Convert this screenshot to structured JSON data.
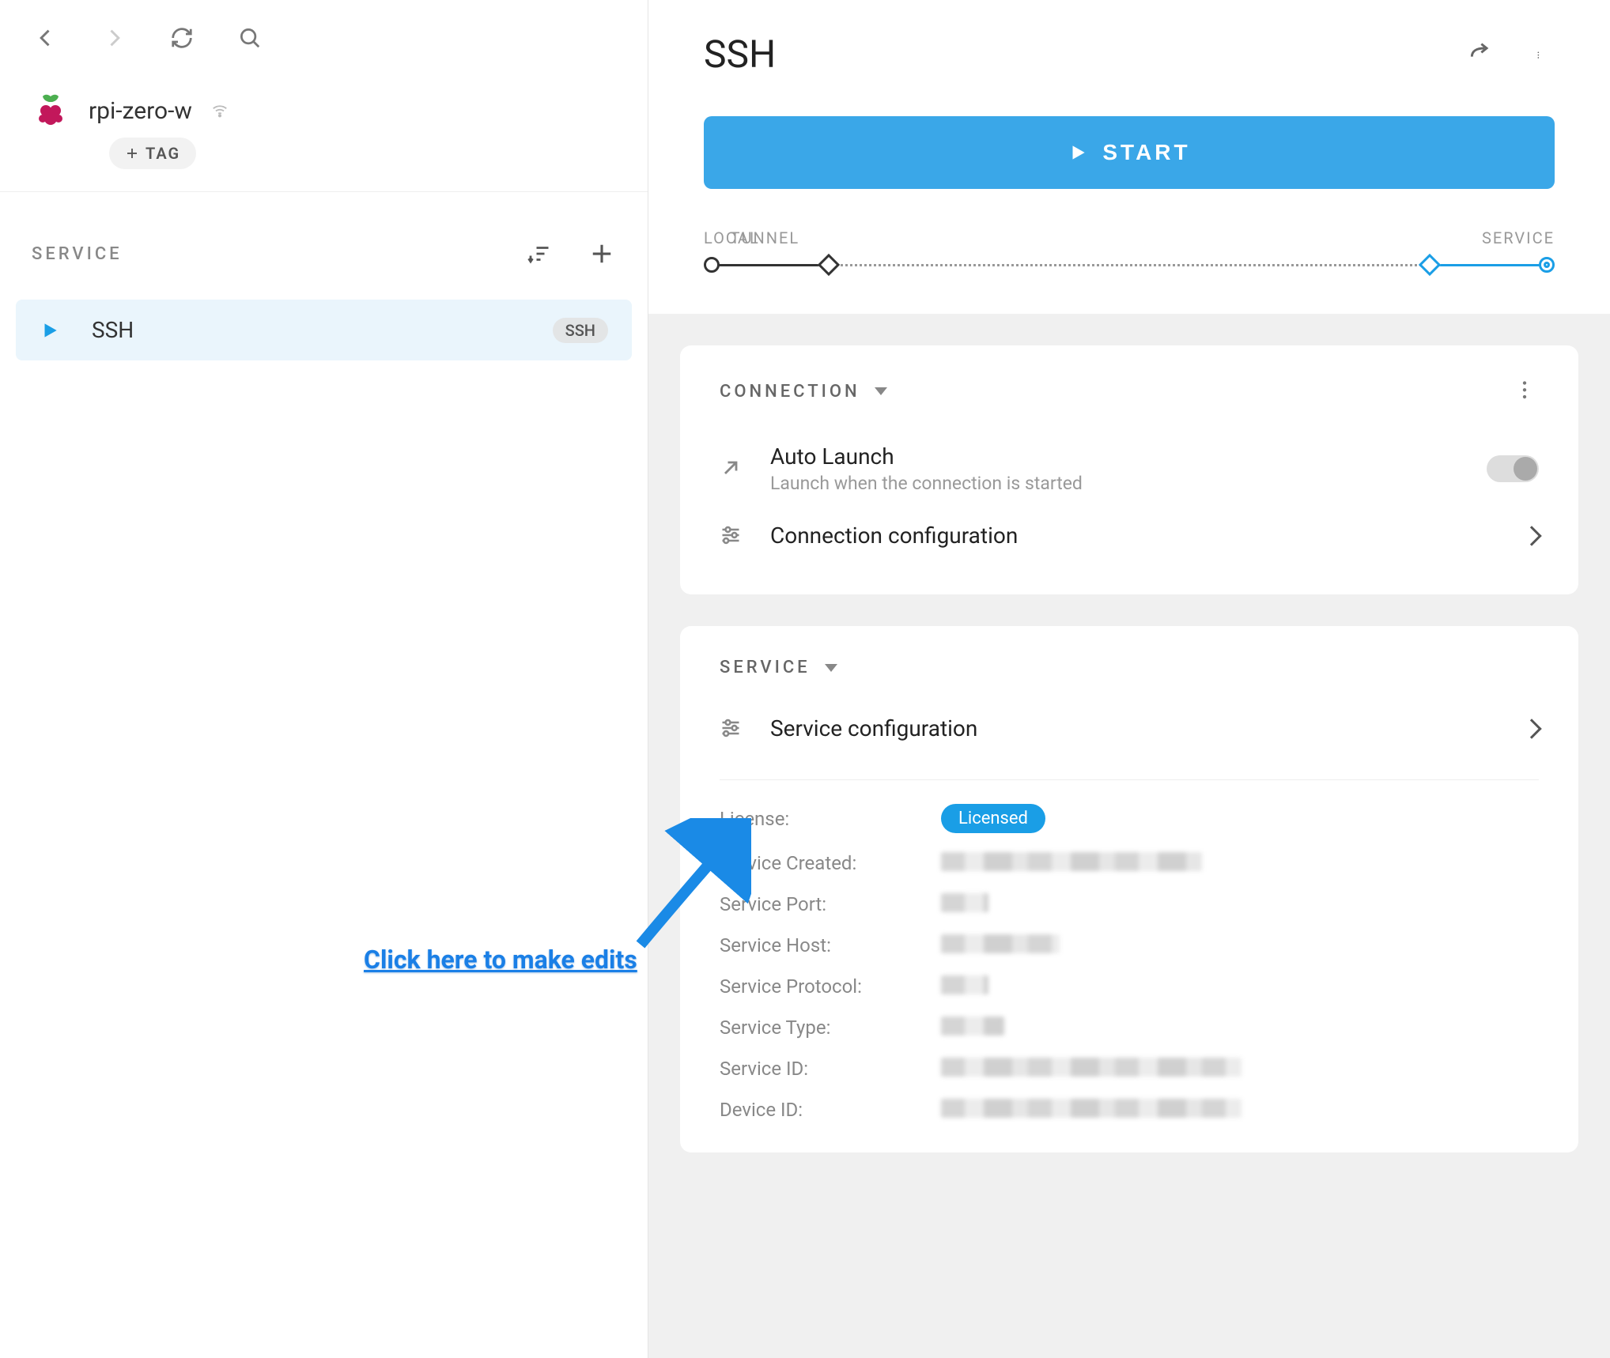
{
  "sidebar": {
    "device_name": "rpi-zero-w",
    "tag_button": "TAG",
    "service_label": "SERVICE",
    "services": [
      {
        "name": "SSH",
        "badge": "SSH"
      }
    ]
  },
  "main": {
    "title": "SSH",
    "start_button": "START",
    "track": {
      "local": "LOCAL",
      "tunnel": "TUNNEL",
      "service": "SERVICE"
    }
  },
  "connection_card": {
    "header": "CONNECTION",
    "auto_launch": {
      "title": "Auto Launch",
      "subtitle": "Launch when the connection is started"
    },
    "config_row": "Connection configuration"
  },
  "service_card": {
    "header": "SERVICE",
    "config_row": "Service configuration",
    "license_label": "License:",
    "license_value": "Licensed",
    "fields": [
      {
        "label": "Service Created:"
      },
      {
        "label": "Service Port:"
      },
      {
        "label": "Service Host:"
      },
      {
        "label": "Service Protocol:"
      },
      {
        "label": "Service Type:"
      },
      {
        "label": "Service ID:"
      },
      {
        "label": "Device ID:"
      }
    ]
  },
  "annotation": "Click here to make edits"
}
